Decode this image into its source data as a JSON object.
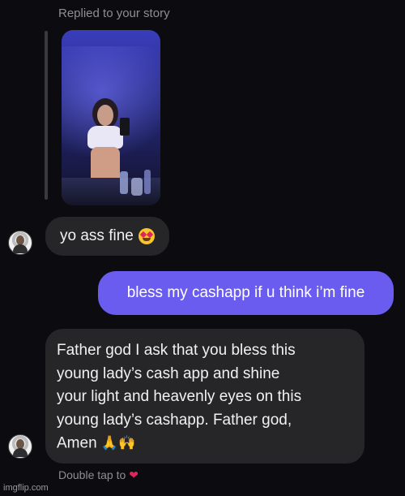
{
  "header": {
    "replied_label": "Replied to your story"
  },
  "story": {
    "kind": "story-photo"
  },
  "messages": [
    {
      "direction": "incoming",
      "text": "yo ass fine",
      "emoji": "smiling-face-with-heart-eyes"
    },
    {
      "direction": "outgoing",
      "text": "bless my cashapp if u think i’m fine"
    },
    {
      "direction": "incoming",
      "lines": [
        "Father god I ask that you bless this",
        "young lady’s cash app and shine",
        "your light and heavenly eyes on this",
        "young lady’s cashapp. Father god,",
        "Amen"
      ],
      "emojis": [
        "folded-hands",
        "raising-hands"
      ]
    }
  ],
  "footer": {
    "hint": "Double tap to",
    "hint_icon": "heart-icon"
  },
  "watermark": "imgflip.com",
  "colors": {
    "background": "#0c0b0f",
    "incoming_bubble": "#262629",
    "outgoing_bubble": "#6b5cf0"
  }
}
